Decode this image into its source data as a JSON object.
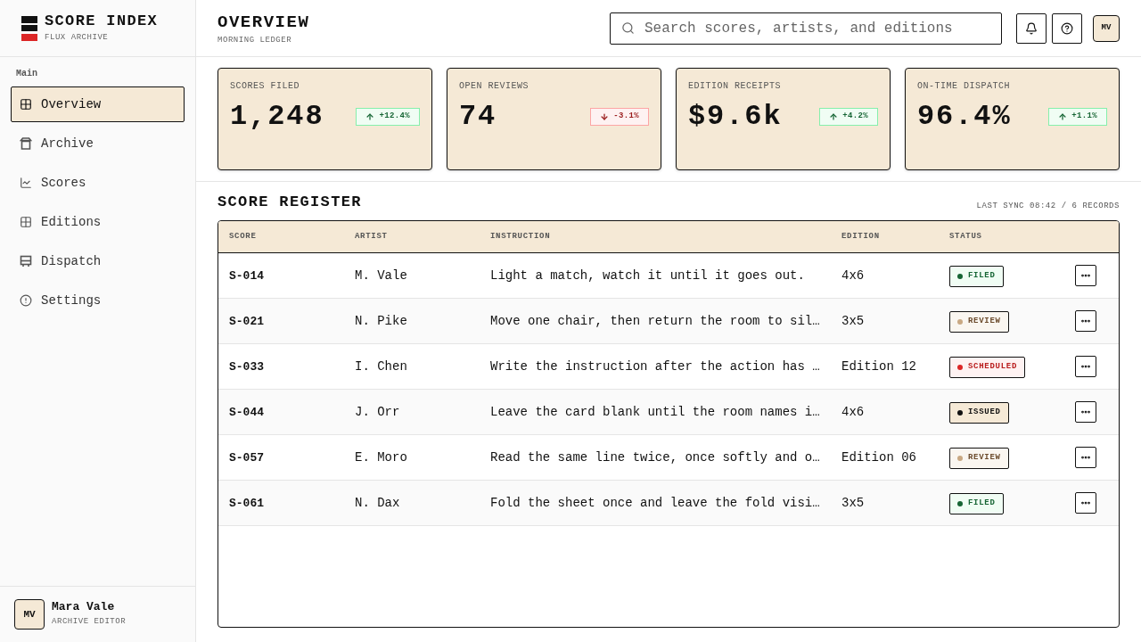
{
  "sidebar": {
    "brand": {
      "title": "SCORE INDEX",
      "subtitle": "FLUX ARCHIVE"
    },
    "section_label": "Main",
    "items": [
      {
        "label": "Overview",
        "selected": true
      },
      {
        "label": "Archive",
        "selected": false
      },
      {
        "label": "Scores",
        "selected": false
      },
      {
        "label": "Editions",
        "selected": false
      },
      {
        "label": "Dispatch",
        "selected": false
      },
      {
        "label": "Settings",
        "selected": false
      }
    ],
    "user": {
      "initials": "MV",
      "name": "Mara Vale",
      "role": "ARCHIVE EDITOR"
    }
  },
  "header": {
    "title": "OVERVIEW",
    "subtitle": "MORNING LEDGER",
    "search": {
      "placeholder": "Search scores, artists, and editions"
    },
    "avatar": "MV"
  },
  "stats": [
    {
      "label": "SCORES FILED",
      "value": "1,248",
      "delta": "+12.4%",
      "kind": "increase"
    },
    {
      "label": "OPEN REVIEWS",
      "value": "74",
      "delta": "-3.1%",
      "kind": "decrease"
    },
    {
      "label": "EDITION RECEIPTS",
      "value": "$9.6k",
      "delta": "+4.2%",
      "kind": "increase"
    },
    {
      "label": "ON-TIME DISPATCH",
      "value": "96.4%",
      "delta": "+1.1%",
      "kind": "increase"
    }
  ],
  "register": {
    "title": "SCORE REGISTER",
    "meta": "LAST SYNC 08:42 / 6 RECORDS",
    "columns": [
      "SCORE",
      "ARTIST",
      "INSTRUCTION",
      "EDITION",
      "STATUS"
    ],
    "rows": [
      {
        "score": "S-014",
        "artist": "M. Vale",
        "instruction": "Light a match, watch it until it goes out.",
        "edition": "4x6",
        "status": {
          "label": "FILED",
          "kind": "success",
          "color": "#166534"
        }
      },
      {
        "score": "S-021",
        "artist": "N. Pike",
        "instruction": "Move one chair, then return the room to sil…",
        "edition": "3x5",
        "status": {
          "label": "REVIEW",
          "kind": "pending",
          "color": "#c9a882"
        }
      },
      {
        "score": "S-033",
        "artist": "I. Chen",
        "instruction": "Write the instruction after the action has …",
        "edition": "Edition 12",
        "status": {
          "label": "SCHEDULED",
          "kind": "alert",
          "color": "#dc2626"
        }
      },
      {
        "score": "S-044",
        "artist": "J. Orr",
        "instruction": "Leave the card blank until the room names i…",
        "edition": "4x6",
        "status": {
          "label": "ISSUED",
          "kind": "neutral",
          "color": "#111111"
        }
      },
      {
        "score": "S-057",
        "artist": "E. Moro",
        "instruction": "Read the same line twice, once softly and o…",
        "edition": "Edition 06",
        "status": {
          "label": "REVIEW",
          "kind": "pending",
          "color": "#c9a882"
        }
      },
      {
        "score": "S-061",
        "artist": "N. Dax",
        "instruction": "Fold the sheet once and leave the fold visi…",
        "edition": "3x5",
        "status": {
          "label": "FILED",
          "kind": "success",
          "color": "#166534"
        }
      }
    ]
  }
}
